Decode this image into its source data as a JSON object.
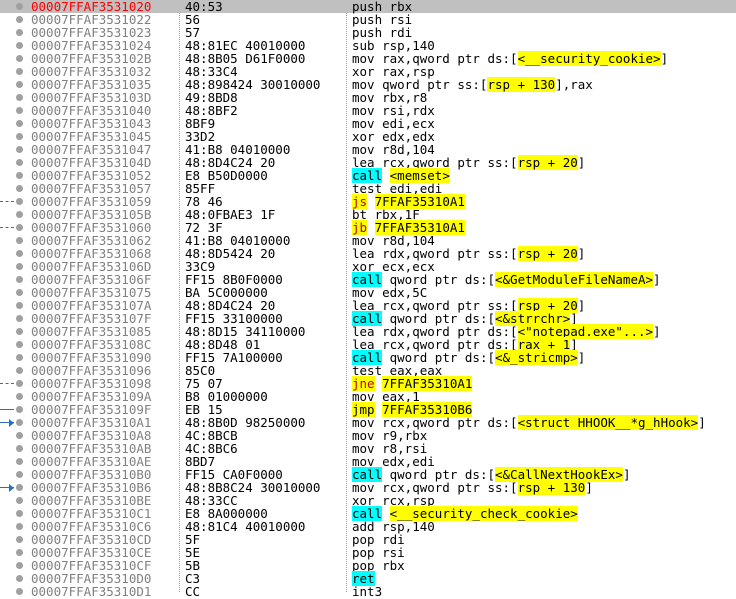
{
  "colors": {
    "selected_addr": "#ff0000",
    "call_bg": "#00ffff",
    "label_bg": "#ffff00",
    "jump_bg": "#ffff00"
  },
  "rows": [
    {
      "addr": "00007FFAF3531020",
      "bytes": "40:53",
      "parts": [
        {
          "t": "push rbx"
        }
      ]
    },
    {
      "addr": "00007FFAF3531022",
      "bytes": "56",
      "parts": [
        {
          "t": "push rsi"
        }
      ]
    },
    {
      "addr": "00007FFAF3531023",
      "bytes": "57",
      "parts": [
        {
          "t": "push rdi"
        }
      ]
    },
    {
      "addr": "00007FFAF3531024",
      "bytes": "48:81EC 40010000",
      "parts": [
        {
          "t": "sub rsp,140"
        }
      ]
    },
    {
      "addr": "00007FFAF353102B",
      "bytes": "48:8B05 D61F0000",
      "parts": [
        {
          "t": "mov rax,qword ptr ds:["
        },
        {
          "t": "<__security_cookie>",
          "c": "hl-y"
        },
        {
          "t": "]"
        }
      ]
    },
    {
      "addr": "00007FFAF3531032",
      "bytes": "48:33C4",
      "parts": [
        {
          "t": "xor rax,rsp"
        }
      ]
    },
    {
      "addr": "00007FFAF3531035",
      "bytes": "48:898424 30010000",
      "parts": [
        {
          "t": "mov qword ptr ss:["
        },
        {
          "t": "rsp + 130",
          "c": "hl-y"
        },
        {
          "t": "],rax"
        }
      ]
    },
    {
      "addr": "00007FFAF353103D",
      "bytes": "49:8BD8",
      "parts": [
        {
          "t": "mov rbx,r8"
        }
      ]
    },
    {
      "addr": "00007FFAF3531040",
      "bytes": "48:8BF2",
      "parts": [
        {
          "t": "mov rsi,rdx"
        }
      ]
    },
    {
      "addr": "00007FFAF3531043",
      "bytes": "8BF9",
      "parts": [
        {
          "t": "mov edi,ecx"
        }
      ]
    },
    {
      "addr": "00007FFAF3531045",
      "bytes": "33D2",
      "parts": [
        {
          "t": "xor edx,edx"
        }
      ]
    },
    {
      "addr": "00007FFAF3531047",
      "bytes": "41:B8 04010000",
      "parts": [
        {
          "t": "mov r8d,104"
        }
      ]
    },
    {
      "addr": "00007FFAF353104D",
      "bytes": "48:8D4C24 20",
      "parts": [
        {
          "t": "lea rcx,qword ptr ss:["
        },
        {
          "t": "rsp + 20",
          "c": "hl-y"
        },
        {
          "t": "]"
        }
      ]
    },
    {
      "addr": "00007FFAF3531052",
      "bytes": "E8 B50D0000",
      "parts": [
        {
          "t": "call",
          "c": "hl-c"
        },
        {
          "t": " "
        },
        {
          "t": "<memset>",
          "c": "hl-y"
        }
      ]
    },
    {
      "addr": "00007FFAF3531057",
      "bytes": "85FF",
      "parts": [
        {
          "t": "test edi,edi"
        }
      ]
    },
    {
      "addr": "00007FFAF3531059",
      "bytes": "78 46",
      "parts": [
        {
          "t": "js",
          "c": "mn-red"
        },
        {
          "t": " "
        },
        {
          "t": "7FFAF35310A1",
          "c": "hl-y"
        }
      ]
    },
    {
      "addr": "00007FFAF353105B",
      "bytes": "48:0FBAE3 1F",
      "parts": [
        {
          "t": "bt rbx,1F"
        }
      ]
    },
    {
      "addr": "00007FFAF3531060",
      "bytes": "72 3F",
      "parts": [
        {
          "t": "jb",
          "c": "mn-red"
        },
        {
          "t": " "
        },
        {
          "t": "7FFAF35310A1",
          "c": "hl-y"
        }
      ]
    },
    {
      "addr": "00007FFAF3531062",
      "bytes": "41:B8 04010000",
      "parts": [
        {
          "t": "mov r8d,104"
        }
      ]
    },
    {
      "addr": "00007FFAF3531068",
      "bytes": "48:8D5424 20",
      "parts": [
        {
          "t": "lea rdx,qword ptr ss:["
        },
        {
          "t": "rsp + 20",
          "c": "hl-y"
        },
        {
          "t": "]"
        }
      ]
    },
    {
      "addr": "00007FFAF353106D",
      "bytes": "33C9",
      "parts": [
        {
          "t": "xor ecx,ecx"
        }
      ]
    },
    {
      "addr": "00007FFAF353106F",
      "bytes": "FF15 8B0F0000",
      "parts": [
        {
          "t": "call",
          "c": "hl-c"
        },
        {
          "t": " qword ptr ds:["
        },
        {
          "t": "<&GetModuleFileNameA>",
          "c": "hl-y"
        },
        {
          "t": "]"
        }
      ]
    },
    {
      "addr": "00007FFAF3531075",
      "bytes": "BA 5C000000",
      "parts": [
        {
          "t": "mov edx,5C"
        }
      ]
    },
    {
      "addr": "00007FFAF353107A",
      "bytes": "48:8D4C24 20",
      "parts": [
        {
          "t": "lea rcx,qword ptr ss:["
        },
        {
          "t": "rsp + 20",
          "c": "hl-y"
        },
        {
          "t": "]"
        }
      ]
    },
    {
      "addr": "00007FFAF353107F",
      "bytes": "FF15 33100000",
      "parts": [
        {
          "t": "call",
          "c": "hl-c"
        },
        {
          "t": " qword ptr ds:["
        },
        {
          "t": "<&strrchr>",
          "c": "hl-y"
        },
        {
          "t": "]"
        }
      ]
    },
    {
      "addr": "00007FFAF3531085",
      "bytes": "48:8D15 34110000",
      "parts": [
        {
          "t": "lea rdx,qword ptr ds:["
        },
        {
          "t": "<\"notepad.exe\"...>",
          "c": "hl-y"
        },
        {
          "t": "]"
        }
      ]
    },
    {
      "addr": "00007FFAF353108C",
      "bytes": "48:8D48 01",
      "parts": [
        {
          "t": "lea rcx,qword ptr ds:["
        },
        {
          "t": "rax + 1",
          "c": "hl-y"
        },
        {
          "t": "]"
        }
      ]
    },
    {
      "addr": "00007FFAF3531090",
      "bytes": "FF15 7A100000",
      "parts": [
        {
          "t": "call",
          "c": "hl-c"
        },
        {
          "t": " qword ptr ds:["
        },
        {
          "t": "<&_stricmp>",
          "c": "hl-y"
        },
        {
          "t": "]"
        }
      ]
    },
    {
      "addr": "00007FFAF3531096",
      "bytes": "85C0",
      "parts": [
        {
          "t": "test eax,eax"
        }
      ]
    },
    {
      "addr": "00007FFAF3531098",
      "bytes": "75 07",
      "parts": [
        {
          "t": "jne",
          "c": "mn-red"
        },
        {
          "t": " "
        },
        {
          "t": "7FFAF35310A1",
          "c": "hl-y"
        }
      ]
    },
    {
      "addr": "00007FFAF353109A",
      "bytes": "B8 01000000",
      "parts": [
        {
          "t": "mov eax,1"
        }
      ]
    },
    {
      "addr": "00007FFAF353109F",
      "bytes": "EB 15",
      "parts": [
        {
          "t": "jmp",
          "c": "hl-y"
        },
        {
          "t": " "
        },
        {
          "t": "7FFAF35310B6",
          "c": "hl-y"
        }
      ]
    },
    {
      "addr": "00007FFAF35310A1",
      "bytes": "48:8B0D 98250000",
      "parts": [
        {
          "t": "mov rcx,qword ptr ds:["
        },
        {
          "t": "<struct HHOOK__*g_hHook>",
          "c": "hl-y"
        },
        {
          "t": "]"
        }
      ]
    },
    {
      "addr": "00007FFAF35310A8",
      "bytes": "4C:8BCB",
      "parts": [
        {
          "t": "mov r9,rbx"
        }
      ]
    },
    {
      "addr": "00007FFAF35310AB",
      "bytes": "4C:8BC6",
      "parts": [
        {
          "t": "mov r8,rsi"
        }
      ]
    },
    {
      "addr": "00007FFAF35310AE",
      "bytes": "8BD7",
      "parts": [
        {
          "t": "mov edx,edi"
        }
      ]
    },
    {
      "addr": "00007FFAF35310B0",
      "bytes": "FF15 CA0F0000",
      "parts": [
        {
          "t": "call",
          "c": "hl-c"
        },
        {
          "t": " qword ptr ds:["
        },
        {
          "t": "<&CallNextHookEx>",
          "c": "hl-y"
        },
        {
          "t": "]"
        }
      ]
    },
    {
      "addr": "00007FFAF35310B6",
      "bytes": "48:8B8C24 30010000",
      "parts": [
        {
          "t": "mov rcx,qword ptr ss:["
        },
        {
          "t": "rsp + 130",
          "c": "hl-y"
        },
        {
          "t": "]"
        }
      ]
    },
    {
      "addr": "00007FFAF35310BE",
      "bytes": "48:33CC",
      "parts": [
        {
          "t": "xor rcx,rsp"
        }
      ]
    },
    {
      "addr": "00007FFAF35310C1",
      "bytes": "E8 8A000000",
      "parts": [
        {
          "t": "call",
          "c": "hl-c"
        },
        {
          "t": " "
        },
        {
          "t": "<__security_check_cookie>",
          "c": "hl-y"
        }
      ]
    },
    {
      "addr": "00007FFAF35310C6",
      "bytes": "48:81C4 40010000",
      "parts": [
        {
          "t": "add rsp,140"
        }
      ]
    },
    {
      "addr": "00007FFAF35310CD",
      "bytes": "5F",
      "parts": [
        {
          "t": "pop rdi"
        }
      ]
    },
    {
      "addr": "00007FFAF35310CE",
      "bytes": "5E",
      "parts": [
        {
          "t": "pop rsi"
        }
      ]
    },
    {
      "addr": "00007FFAF35310CF",
      "bytes": "5B",
      "parts": [
        {
          "t": "pop rbx"
        }
      ]
    },
    {
      "addr": "00007FFAF35310D0",
      "bytes": "C3",
      "parts": [
        {
          "t": "ret",
          "c": "hl-c"
        }
      ]
    },
    {
      "addr": "00007FFAF35310D1",
      "bytes": "CC",
      "parts": [
        {
          "t": "int3"
        }
      ]
    }
  ]
}
